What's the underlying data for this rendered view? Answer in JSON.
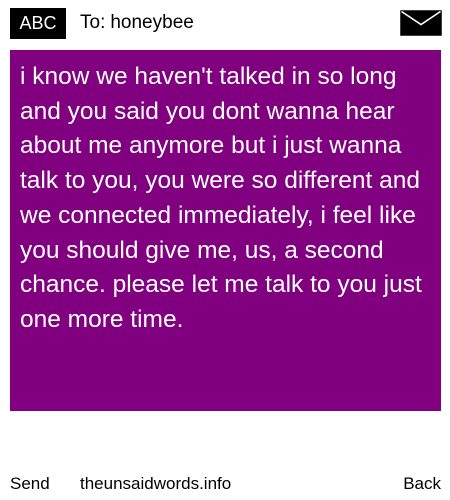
{
  "header": {
    "keyboard_mode_label": "ABC",
    "to_prefix": "To:",
    "recipient": "honeybee",
    "envelope_icon": "envelope-icon"
  },
  "message": {
    "body": "i know we haven't talked in so long and you said you dont wanna hear about me anymore but i just wanna talk to you, you were so different and we connected immediately, i feel like you should give me, us, a second chance. please let me talk to you just one more time."
  },
  "footer": {
    "send_label": "Send",
    "site_label": "theunsaidwords.info",
    "back_label": "Back"
  },
  "colors": {
    "message_background": "#800080",
    "message_text": "#ffffff",
    "badge_background": "#000000",
    "page_background": "#ffffff"
  }
}
